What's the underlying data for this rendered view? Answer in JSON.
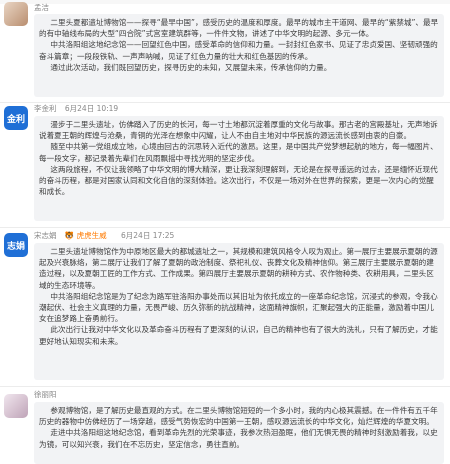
{
  "posts": [
    {
      "author": "孟洁",
      "date": "",
      "badge": "",
      "avatar_text": "",
      "paragraphs": [
        "二里头夏都遗址博物馆——探寻“最早中国”，感受历史的温度和厚度。最早的城市主干道网、最早的“紫禁城”、最早的有中轴线布局的大型“四合院”式宫室建筑群等，一件件文物，讲述了中华文明的起源、多元一体。",
        "中共洛阳组这地纪念馆——回望红色中国，感受革命的信仰和力量。一封封红色家书、见证了忠贞爱国、坚韧顽强的奋斗篇章；一段段铁轨、一声声呐喊，见证了红色力量的壮大和红色基因的传承。",
        "通过此次活动，我们既回望历史，探寻历史的未知，又展望未来，传承信仰的力量。"
      ]
    },
    {
      "author": "李金利",
      "date": "6月24日 10:19",
      "badge": "",
      "avatar_text": "金利",
      "paragraphs": [
        "漫步于二里头遗址，仿佛踏入了历史的长河，每一寸土地都沉淀着厚重的文化与故事。那古老的宫殿基址，无声地诉说着夏王朝的辉煌与沧桑，青铜的光泽在想象中闪耀，让人不由自主地对中华民族的源远流长感到由衷的自豪。",
        "随至中共第一党组成立地，心境由回古的沉思转入近代的激昂。这里，是中国共产党梦想起航的地方，每一幅图片、每一段文字，都记录着先辈们在风雨飘摇中寻找光明的坚定步伐。",
        "这两段旅程，不仅让我领略了中华文明的博大精深，更让我深刻理解到，无论是在探寻遥远的过去，还是缅怀近现代的奋斗历程，都是对国家认同和文化自信的深刻体验。这次出行，不仅是一场对外在世界的探索，更是一次内心的觉醒和成长。"
      ]
    },
    {
      "author": "宋志娟",
      "date": "6月24日 17:25",
      "badge": "虎虎生威",
      "avatar_text": "志娟",
      "paragraphs": [
        "二里头遗址博物馆作为中原地区最大的都城遗址之一，其规模和建筑风格令人叹为观止。第一展厅主要展示夏朝的源起及兴衰脉络，第二展厅让我们了解了夏朝的政治制度、祭祀礼仪、丧葬文化及精神信仰。第三展厅主要展示夏朝的建造过程，以及夏朝工匠的工作方式、工作成果。第四展厅主要展示夏朝的耕种方式、农作物种类、农耕用具，二里头区域的生态环境等。",
        "中共洛阳组纪念馆是为了纪念为路军驻洛阳办事处而以其旧址为依托成立的一座革命纪念馆，沉浸式的参观，令我心潮起伏、社会主义真理的力量，无畏严峻、历久弥新的抗战精神，这面精神旗帜，汇聚起强大的正能量，激励着中国儿女在追梦路上奋勇前行。",
        "此次出行让我对中华文化以及革命奋斗历程有了更深刻的认识，自己的精神也有了很大的洗礼，只有了解历史，才能更好地认知现实和未来。"
      ]
    },
    {
      "author": "徐丽阳",
      "date": "",
      "badge": "",
      "avatar_text": "",
      "paragraphs": [
        "参观博物馆，是了解历史最直观的方式。在二里头博物馆短短的一个多小时，我的内心极其震撼。在一件件有五千年历史的器物中仿佛经历了一场穿越，感受气势恢宏的中国第一王朝，感叹源远流长的中华文化，灿烂辉煌的华夏文明。",
        "走进中共洛阳组这地纪念馆，看到革命先烈的光荣事迹，我参次热泪盈眶，他们无惧无畏的精神时刻激励着我，以史为镜，可以知兴衰，我们在不忘历史，坚定信念，勇往直前。"
      ]
    }
  ]
}
